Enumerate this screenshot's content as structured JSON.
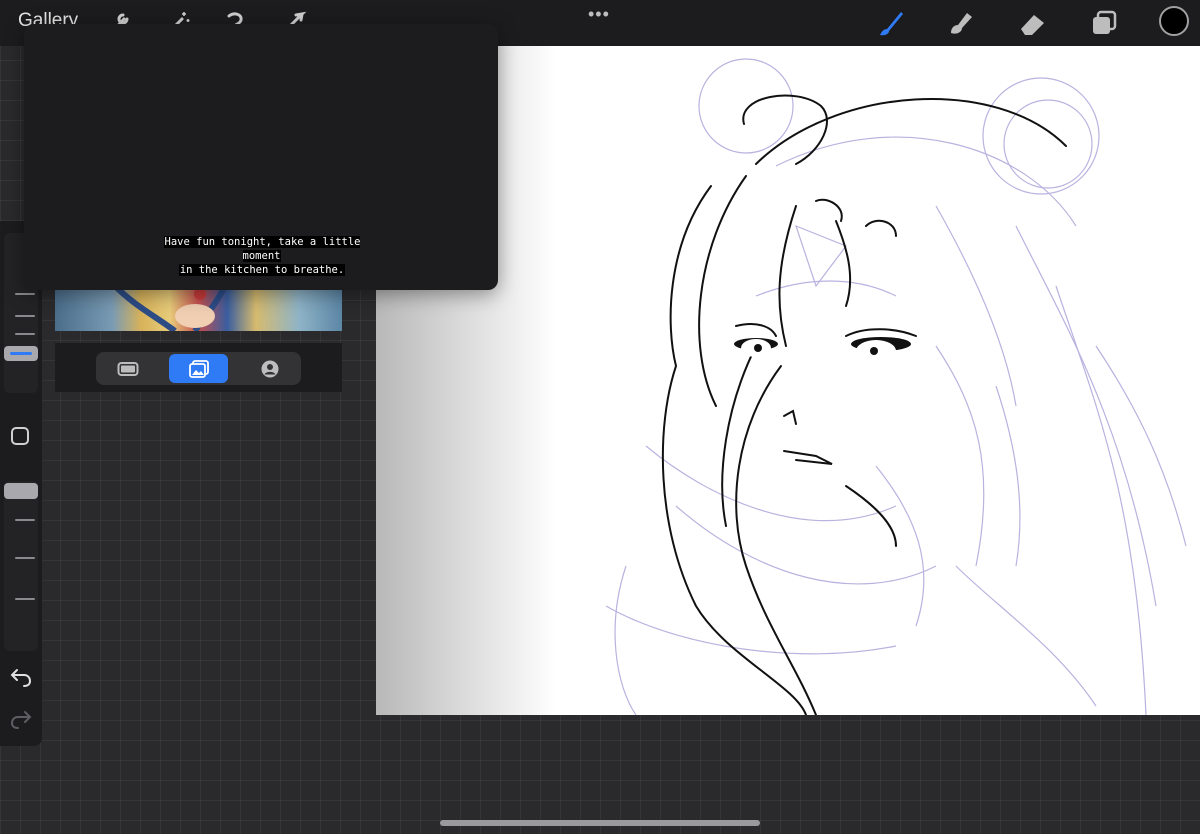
{
  "topbar": {
    "gallery_label": "Gallery",
    "more_icon": "•••",
    "brush_color": "#2f7bf5",
    "current_color": "#000000"
  },
  "popup": {
    "caption_line1": "Have fun tonight, take a little moment",
    "caption_line2": "in the kitchen to breathe."
  },
  "reference": {
    "tabs": [
      "canvas-tab",
      "image-tab",
      "face-tab"
    ],
    "selected_tab": "image-tab"
  },
  "sidebar": {
    "brush_size_level": 0.35,
    "opacity_level": 0.1
  }
}
